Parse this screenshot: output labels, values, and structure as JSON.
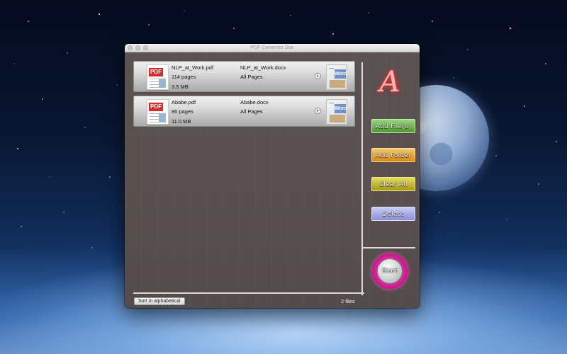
{
  "window": {
    "title": "PDF Converter Star"
  },
  "files": [
    {
      "source_name": "NLP_at_Work.pdf",
      "pages": "114 pages",
      "size": "3.5 MB",
      "target_name": "NLP_at_Work.docx",
      "range": "All Pages"
    },
    {
      "source_name": "Ababe.pdf",
      "pages": "86 pages",
      "size": "11.0 MB",
      "target_name": "Ababe.docx",
      "range": "All Pages"
    }
  ],
  "thumbnails": {
    "pdf_label": "PDF",
    "word_label": "Word"
  },
  "sidebar": {
    "add_files": "Add File(s)",
    "add_folder": "Add Folder",
    "clear_all": "Clear All",
    "delete": "Delete",
    "start": "Start"
  },
  "footer": {
    "sort_label": "Sort in alphabetical",
    "file_count": "2 files"
  },
  "icons": {
    "logo": "script-a-logo",
    "plus": "plus-icon"
  },
  "colors": {
    "add_files": "#5aa83a",
    "add_folder": "#e39a22",
    "clear_all": "#b8ac1e",
    "delete": "#9ea2e2",
    "start_ring": "#d41e96"
  }
}
